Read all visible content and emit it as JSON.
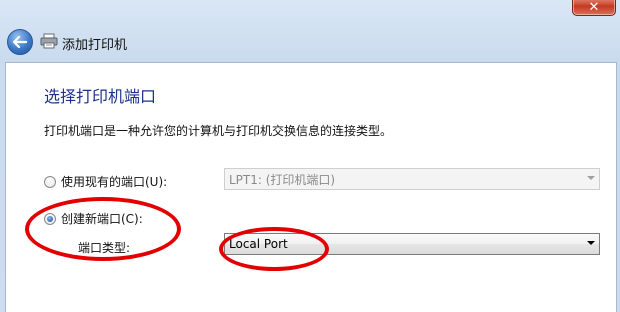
{
  "window": {
    "close_glyph": "✕"
  },
  "nav": {
    "title": "添加打印机"
  },
  "page": {
    "heading": "选择打印机端口",
    "description": "打印机端口是一种允许您的计算机与打印机交换信息的连接类型。"
  },
  "options": {
    "existing_port": {
      "label": "使用现有的端口(U):",
      "selected": false,
      "value": "LPT1: (打印机端口)",
      "enabled": false
    },
    "new_port": {
      "label": "创建新端口(C):",
      "selected": true
    },
    "port_type": {
      "label": "端口类型:",
      "value": "Local Port",
      "enabled": true
    }
  },
  "colors": {
    "heading": "#1e3287",
    "annotation": "#e30000",
    "close_button": "#c23a21"
  },
  "icons": {
    "back": "back-arrow-icon",
    "printer": "printer-icon",
    "dropdown": "chevron-down-icon"
  }
}
